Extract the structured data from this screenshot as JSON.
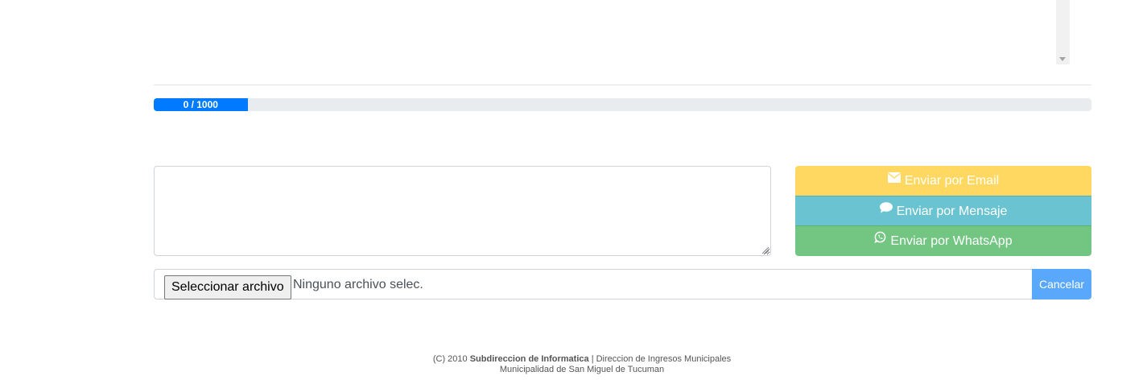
{
  "progress": {
    "label": "0 / 1000",
    "value": 0,
    "max": 1000,
    "displayed_fill_fraction": 0.1,
    "color": "#007bff"
  },
  "message": {
    "value": ""
  },
  "send_buttons": {
    "email": {
      "label": "Enviar por Email",
      "icon": "envelope-icon",
      "color": "#ffd862"
    },
    "message": {
      "label": "Enviar por Mensaje",
      "icon": "comment-icon",
      "color": "#6ac3d1"
    },
    "whatsapp": {
      "label": "Enviar por WhatsApp",
      "icon": "whatsapp-icon",
      "color": "#72c682"
    }
  },
  "file_input": {
    "button_label": "Seleccionar archivo",
    "status": "Ninguno archivo selec.",
    "cancel_label": "Cancelar",
    "cancel_color": "#5aa8fc"
  },
  "footer": {
    "copyright": "(C) 2010",
    "org": "Subdireccion de Informatica",
    "separator": "|",
    "dept": "Direccion de Ingresos Municipales",
    "municipality": "Municipalidad de San Miguel de Tucuman"
  }
}
